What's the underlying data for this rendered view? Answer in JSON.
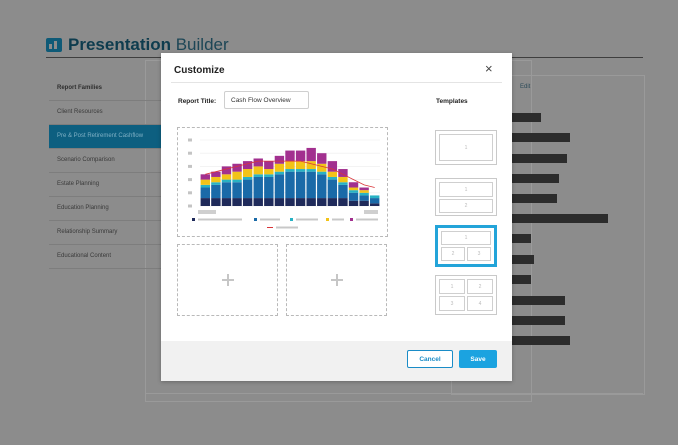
{
  "app": {
    "title_bold": "Presentation",
    "title_thin": "Builder",
    "right_panel_edit": "Edit"
  },
  "sidebar": {
    "header": "Report Families",
    "items": [
      {
        "label": "Client Resources",
        "active": false
      },
      {
        "label": "Pre & Post Retirement Cashflow",
        "active": true
      },
      {
        "label": "Scenario Comparison",
        "active": false
      },
      {
        "label": "Estate Planning",
        "active": false
      },
      {
        "label": "Education Planning",
        "active": false
      },
      {
        "label": "Relationship Summary",
        "active": false
      },
      {
        "label": "Educational Content",
        "active": false
      }
    ]
  },
  "modal": {
    "title": "Customize",
    "close_icon": "×",
    "report_title_label": "Report Title:",
    "report_title_value": "Cash Flow Overview",
    "templates_label": "Templates",
    "templates": [
      {
        "name": "one-slot",
        "cells": [
          "1"
        ],
        "selected": false
      },
      {
        "name": "two-stacked",
        "cells": [
          "1",
          "2"
        ],
        "selected": false
      },
      {
        "name": "one-top-two-bottom",
        "cells": [
          "1",
          "2",
          "3"
        ],
        "selected": true
      },
      {
        "name": "four-grid",
        "cells": [
          "1",
          "2",
          "3",
          "4"
        ],
        "selected": false
      }
    ],
    "cancel_label": "Cancel",
    "save_label": "Save"
  },
  "colors": {
    "accent": "#1ba3e0",
    "selected_border": "#23a4d9",
    "sidebar_active": "#0d5f80",
    "series": [
      "#1f2a5a",
      "#1a6aa8",
      "#28b2c4",
      "#f2c318",
      "#a2308f"
    ],
    "line": "#d9353a"
  },
  "chart_data": {
    "type": "bar",
    "stacked": true,
    "categories_count": 17,
    "series": [
      {
        "values": [
          3,
          3,
          3,
          3,
          3,
          3,
          3,
          3,
          3,
          3,
          3,
          3,
          3,
          3,
          2,
          2,
          1
        ]
      },
      {
        "values": [
          4,
          5,
          6,
          6,
          7,
          8,
          8,
          9,
          10,
          10,
          10,
          9,
          7,
          5,
          3,
          2,
          2
        ]
      },
      {
        "values": [
          1,
          1,
          1,
          1,
          1,
          1,
          1,
          1,
          1,
          1,
          1,
          1,
          1,
          1,
          1,
          1,
          1
        ]
      },
      {
        "values": [
          2,
          2,
          2,
          3,
          3,
          3,
          2,
          3,
          3,
          3,
          3,
          3,
          2,
          2,
          1,
          1,
          0
        ]
      },
      {
        "values": [
          2,
          2,
          3,
          3,
          3,
          3,
          3,
          3,
          4,
          4,
          5,
          4,
          4,
          3,
          2,
          1,
          0
        ]
      }
    ],
    "line_values": [
      12,
      13,
      14,
      15,
      16,
      17,
      17,
      17,
      17,
      17,
      16,
      15,
      14,
      12,
      10,
      8,
      7
    ],
    "ylim": [
      0,
      25
    ],
    "grid": true
  }
}
